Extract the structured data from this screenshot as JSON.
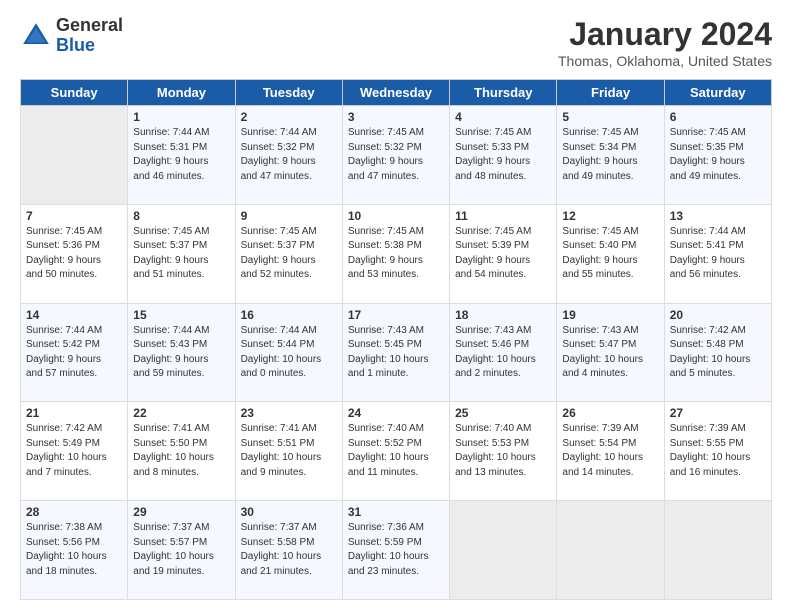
{
  "logo": {
    "general": "General",
    "blue": "Blue"
  },
  "title": "January 2024",
  "location": "Thomas, Oklahoma, United States",
  "days_of_week": [
    "Sunday",
    "Monday",
    "Tuesday",
    "Wednesday",
    "Thursday",
    "Friday",
    "Saturday"
  ],
  "weeks": [
    [
      {
        "day": "",
        "info": ""
      },
      {
        "day": "1",
        "info": "Sunrise: 7:44 AM\nSunset: 5:31 PM\nDaylight: 9 hours\nand 46 minutes."
      },
      {
        "day": "2",
        "info": "Sunrise: 7:44 AM\nSunset: 5:32 PM\nDaylight: 9 hours\nand 47 minutes."
      },
      {
        "day": "3",
        "info": "Sunrise: 7:45 AM\nSunset: 5:32 PM\nDaylight: 9 hours\nand 47 minutes."
      },
      {
        "day": "4",
        "info": "Sunrise: 7:45 AM\nSunset: 5:33 PM\nDaylight: 9 hours\nand 48 minutes."
      },
      {
        "day": "5",
        "info": "Sunrise: 7:45 AM\nSunset: 5:34 PM\nDaylight: 9 hours\nand 49 minutes."
      },
      {
        "day": "6",
        "info": "Sunrise: 7:45 AM\nSunset: 5:35 PM\nDaylight: 9 hours\nand 49 minutes."
      }
    ],
    [
      {
        "day": "7",
        "info": "Sunrise: 7:45 AM\nSunset: 5:36 PM\nDaylight: 9 hours\nand 50 minutes."
      },
      {
        "day": "8",
        "info": "Sunrise: 7:45 AM\nSunset: 5:37 PM\nDaylight: 9 hours\nand 51 minutes."
      },
      {
        "day": "9",
        "info": "Sunrise: 7:45 AM\nSunset: 5:37 PM\nDaylight: 9 hours\nand 52 minutes."
      },
      {
        "day": "10",
        "info": "Sunrise: 7:45 AM\nSunset: 5:38 PM\nDaylight: 9 hours\nand 53 minutes."
      },
      {
        "day": "11",
        "info": "Sunrise: 7:45 AM\nSunset: 5:39 PM\nDaylight: 9 hours\nand 54 minutes."
      },
      {
        "day": "12",
        "info": "Sunrise: 7:45 AM\nSunset: 5:40 PM\nDaylight: 9 hours\nand 55 minutes."
      },
      {
        "day": "13",
        "info": "Sunrise: 7:44 AM\nSunset: 5:41 PM\nDaylight: 9 hours\nand 56 minutes."
      }
    ],
    [
      {
        "day": "14",
        "info": "Sunrise: 7:44 AM\nSunset: 5:42 PM\nDaylight: 9 hours\nand 57 minutes."
      },
      {
        "day": "15",
        "info": "Sunrise: 7:44 AM\nSunset: 5:43 PM\nDaylight: 9 hours\nand 59 minutes."
      },
      {
        "day": "16",
        "info": "Sunrise: 7:44 AM\nSunset: 5:44 PM\nDaylight: 10 hours\nand 0 minutes."
      },
      {
        "day": "17",
        "info": "Sunrise: 7:43 AM\nSunset: 5:45 PM\nDaylight: 10 hours\nand 1 minute."
      },
      {
        "day": "18",
        "info": "Sunrise: 7:43 AM\nSunset: 5:46 PM\nDaylight: 10 hours\nand 2 minutes."
      },
      {
        "day": "19",
        "info": "Sunrise: 7:43 AM\nSunset: 5:47 PM\nDaylight: 10 hours\nand 4 minutes."
      },
      {
        "day": "20",
        "info": "Sunrise: 7:42 AM\nSunset: 5:48 PM\nDaylight: 10 hours\nand 5 minutes."
      }
    ],
    [
      {
        "day": "21",
        "info": "Sunrise: 7:42 AM\nSunset: 5:49 PM\nDaylight: 10 hours\nand 7 minutes."
      },
      {
        "day": "22",
        "info": "Sunrise: 7:41 AM\nSunset: 5:50 PM\nDaylight: 10 hours\nand 8 minutes."
      },
      {
        "day": "23",
        "info": "Sunrise: 7:41 AM\nSunset: 5:51 PM\nDaylight: 10 hours\nand 9 minutes."
      },
      {
        "day": "24",
        "info": "Sunrise: 7:40 AM\nSunset: 5:52 PM\nDaylight: 10 hours\nand 11 minutes."
      },
      {
        "day": "25",
        "info": "Sunrise: 7:40 AM\nSunset: 5:53 PM\nDaylight: 10 hours\nand 13 minutes."
      },
      {
        "day": "26",
        "info": "Sunrise: 7:39 AM\nSunset: 5:54 PM\nDaylight: 10 hours\nand 14 minutes."
      },
      {
        "day": "27",
        "info": "Sunrise: 7:39 AM\nSunset: 5:55 PM\nDaylight: 10 hours\nand 16 minutes."
      }
    ],
    [
      {
        "day": "28",
        "info": "Sunrise: 7:38 AM\nSunset: 5:56 PM\nDaylight: 10 hours\nand 18 minutes."
      },
      {
        "day": "29",
        "info": "Sunrise: 7:37 AM\nSunset: 5:57 PM\nDaylight: 10 hours\nand 19 minutes."
      },
      {
        "day": "30",
        "info": "Sunrise: 7:37 AM\nSunset: 5:58 PM\nDaylight: 10 hours\nand 21 minutes."
      },
      {
        "day": "31",
        "info": "Sunrise: 7:36 AM\nSunset: 5:59 PM\nDaylight: 10 hours\nand 23 minutes."
      },
      {
        "day": "",
        "info": ""
      },
      {
        "day": "",
        "info": ""
      },
      {
        "day": "",
        "info": ""
      }
    ]
  ]
}
